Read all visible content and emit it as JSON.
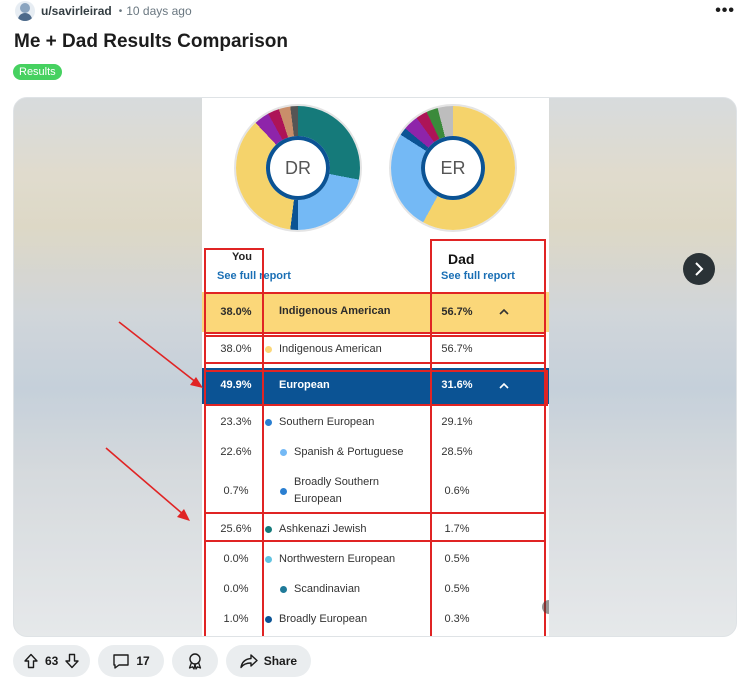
{
  "post": {
    "username": "u/savirleirad",
    "separator": "•",
    "timestamp": "10 days ago",
    "more_label": "•••",
    "title": "Me + Dad Results Comparison",
    "flair": "Results"
  },
  "gallery": {
    "donut_you_label": "DR",
    "donut_dad_label": "ER",
    "you_header": "You",
    "dad_header": "Dad",
    "see_full_report": "See full report",
    "rows": [
      {
        "you": "38.0%",
        "name": "Indigenous American",
        "dad": "56.7%"
      },
      {
        "you": "38.0%",
        "name": "Indigenous American",
        "dad": "56.7%"
      },
      {
        "you": "49.9%",
        "name": "European",
        "dad": "31.6%"
      },
      {
        "you": "23.3%",
        "name": "Southern European",
        "dad": "29.1%"
      },
      {
        "you": "22.6%",
        "name": "Spanish & Portuguese",
        "dad": "28.5%"
      },
      {
        "you": "0.7%",
        "name": "Broadly Southern European",
        "name_line1": "Broadly Southern",
        "name_line2": "European",
        "dad": "0.6%"
      },
      {
        "you": "25.6%",
        "name": "Ashkenazi Jewish",
        "dad": "1.7%"
      },
      {
        "you": "0.0%",
        "name": "Northwestern European",
        "dad": "0.5%"
      },
      {
        "you": "0.0%",
        "name": "Scandinavian",
        "dad": "0.5%"
      },
      {
        "you": "1.0%",
        "name": "Broadly European",
        "dad": "0.3%"
      }
    ],
    "colors": {
      "indigenous": "#fbd779",
      "european": "#0b5394",
      "southern": "#2a7fd1",
      "spanish": "#74b9f5",
      "ashkenazi": "#157a7a",
      "northwestern": "#62c3e0",
      "scandinavian": "#1f7a99",
      "broadly_european": "#0b5394",
      "annotation": "#e02424"
    },
    "pager": {
      "current": 1,
      "total": 3
    }
  },
  "actions": {
    "upvotes": "63",
    "comments": "17",
    "share_label": "Share"
  }
}
